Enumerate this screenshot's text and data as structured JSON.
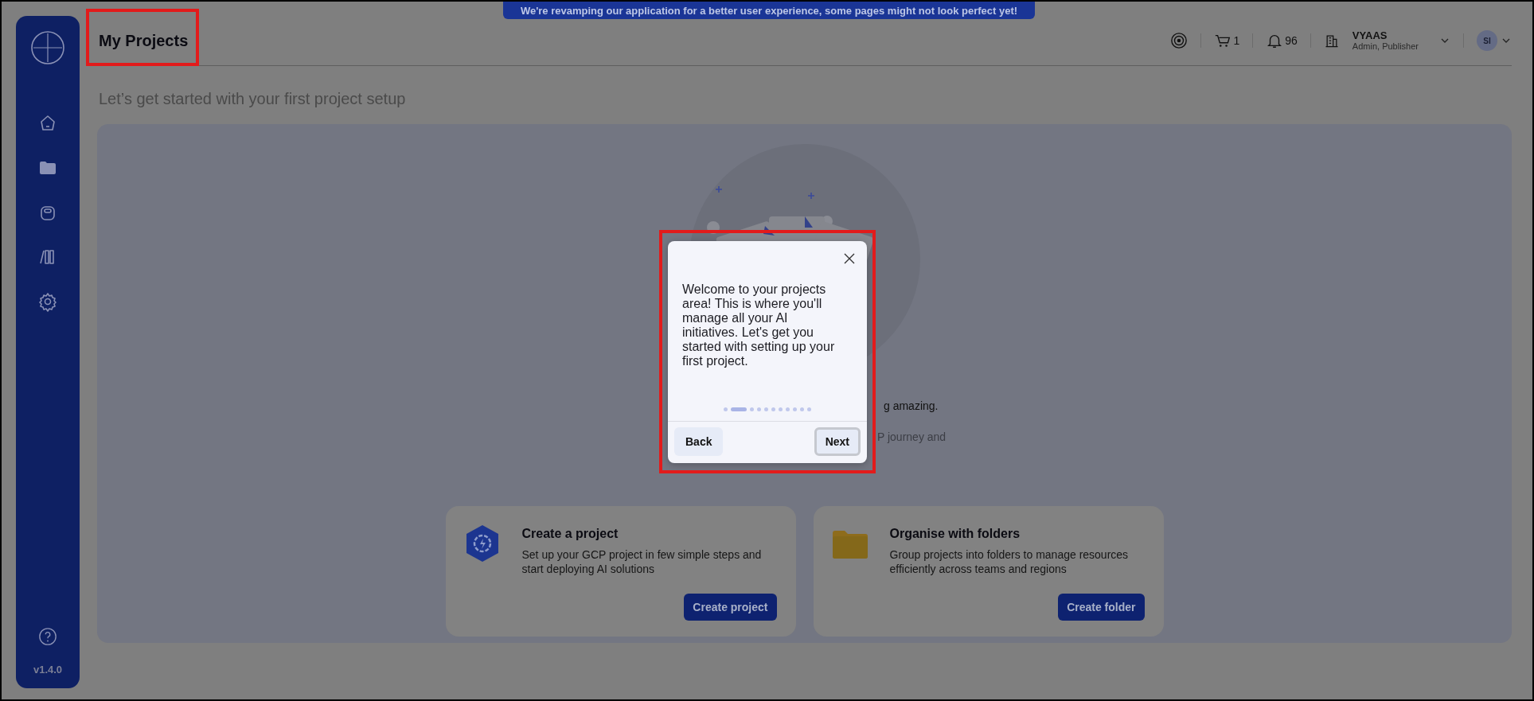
{
  "banner": {
    "text": "We're revamping our application for a better user experience, some pages might not look perfect yet!"
  },
  "header": {
    "title": "My Projects",
    "cart_count": "1",
    "notifications_count": "96",
    "user": {
      "name": "VYAAS",
      "roles": "Admin, Publisher"
    },
    "avatar_initials": "SI"
  },
  "sidebar": {
    "version": "v1.4.0"
  },
  "subtitle": "Let’s get started with your first project setup",
  "hero": {
    "texts": [
      {
        "kind": "line",
        "text": "g amazing."
      },
      {
        "kind": "muted",
        "text": "P journey and"
      }
    ]
  },
  "cards": [
    {
      "kind": "project",
      "title": "Create a project",
      "description": "Set up your GCP project in few simple steps and start deploying AI solutions",
      "button": "Create project"
    },
    {
      "kind": "folder",
      "title": "Organise with folders",
      "description": "Group projects into folders to manage resources efficiently across teams and regions",
      "button": "Create folder"
    }
  ],
  "tour": {
    "message": "Welcome to your projects area! This is where you'll manage all your AI initiatives. Let's get you started with setting up your first project.",
    "steps": [
      {
        "selected": false
      },
      {
        "selected": true
      },
      {
        "selected": false
      },
      {
        "selected": false
      },
      {
        "selected": false
      },
      {
        "selected": false
      },
      {
        "selected": false
      },
      {
        "selected": false
      },
      {
        "selected": false
      },
      {
        "selected": false
      },
      {
        "selected": false
      }
    ],
    "back": "Back",
    "next": {
      "label": "Next",
      "focused": true
    }
  },
  "highlights": {
    "title": true,
    "tour": true
  }
}
